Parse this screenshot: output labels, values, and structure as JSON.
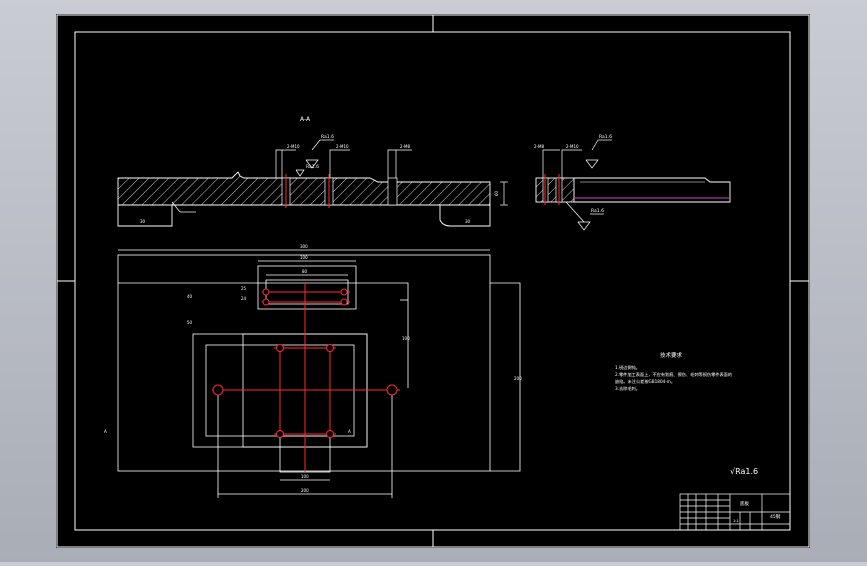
{
  "colors": {
    "background": "#000000",
    "border": "#ffffff",
    "centerline": "#ff2a2a",
    "purple_line": "#cc44cc",
    "hatch": "#ffffff"
  },
  "section_views": {
    "left_section_label": "A-A",
    "left_roughness_1": "Ra1.6",
    "left_roughness_2": "Ra1.6",
    "left_callout_1": "2-M10",
    "left_callout_2": "2-M10",
    "left_callout_3": "2-M8",
    "left_height_dim": "60",
    "right_roughness_1": "Ra1.6",
    "right_roughness_2": "Ra1.6",
    "right_callout_1": "2-M8",
    "right_callout_2": "2-M10"
  },
  "plan_view": {
    "dim_total_width": "300",
    "dim_top_width": "100",
    "dim_top_inner": "80",
    "dim_bottom_1": "100",
    "dim_bottom_2": "200",
    "dim_left_1": "25",
    "dim_left_2": "24",
    "dim_left_3": "40",
    "dim_left_4": "50",
    "dim_right": "100",
    "dim_height": "200",
    "marker_left": "A",
    "marker_right": "A"
  },
  "tech_requirements": {
    "title": "技术要求",
    "line_1": "1.锐边倒钝。",
    "line_2": "2.零件加工表面上，不应有划痕、擦伤、毛刺等损伤零件表面的",
    "line_3": "缺陷。未注公差按GB1804-m。",
    "line_4": "3.去除毛刺。"
  },
  "roughness_note": "√Ra1.6",
  "title_block": {
    "part_name": "底板",
    "material": "45钢",
    "scale": "1:1"
  }
}
